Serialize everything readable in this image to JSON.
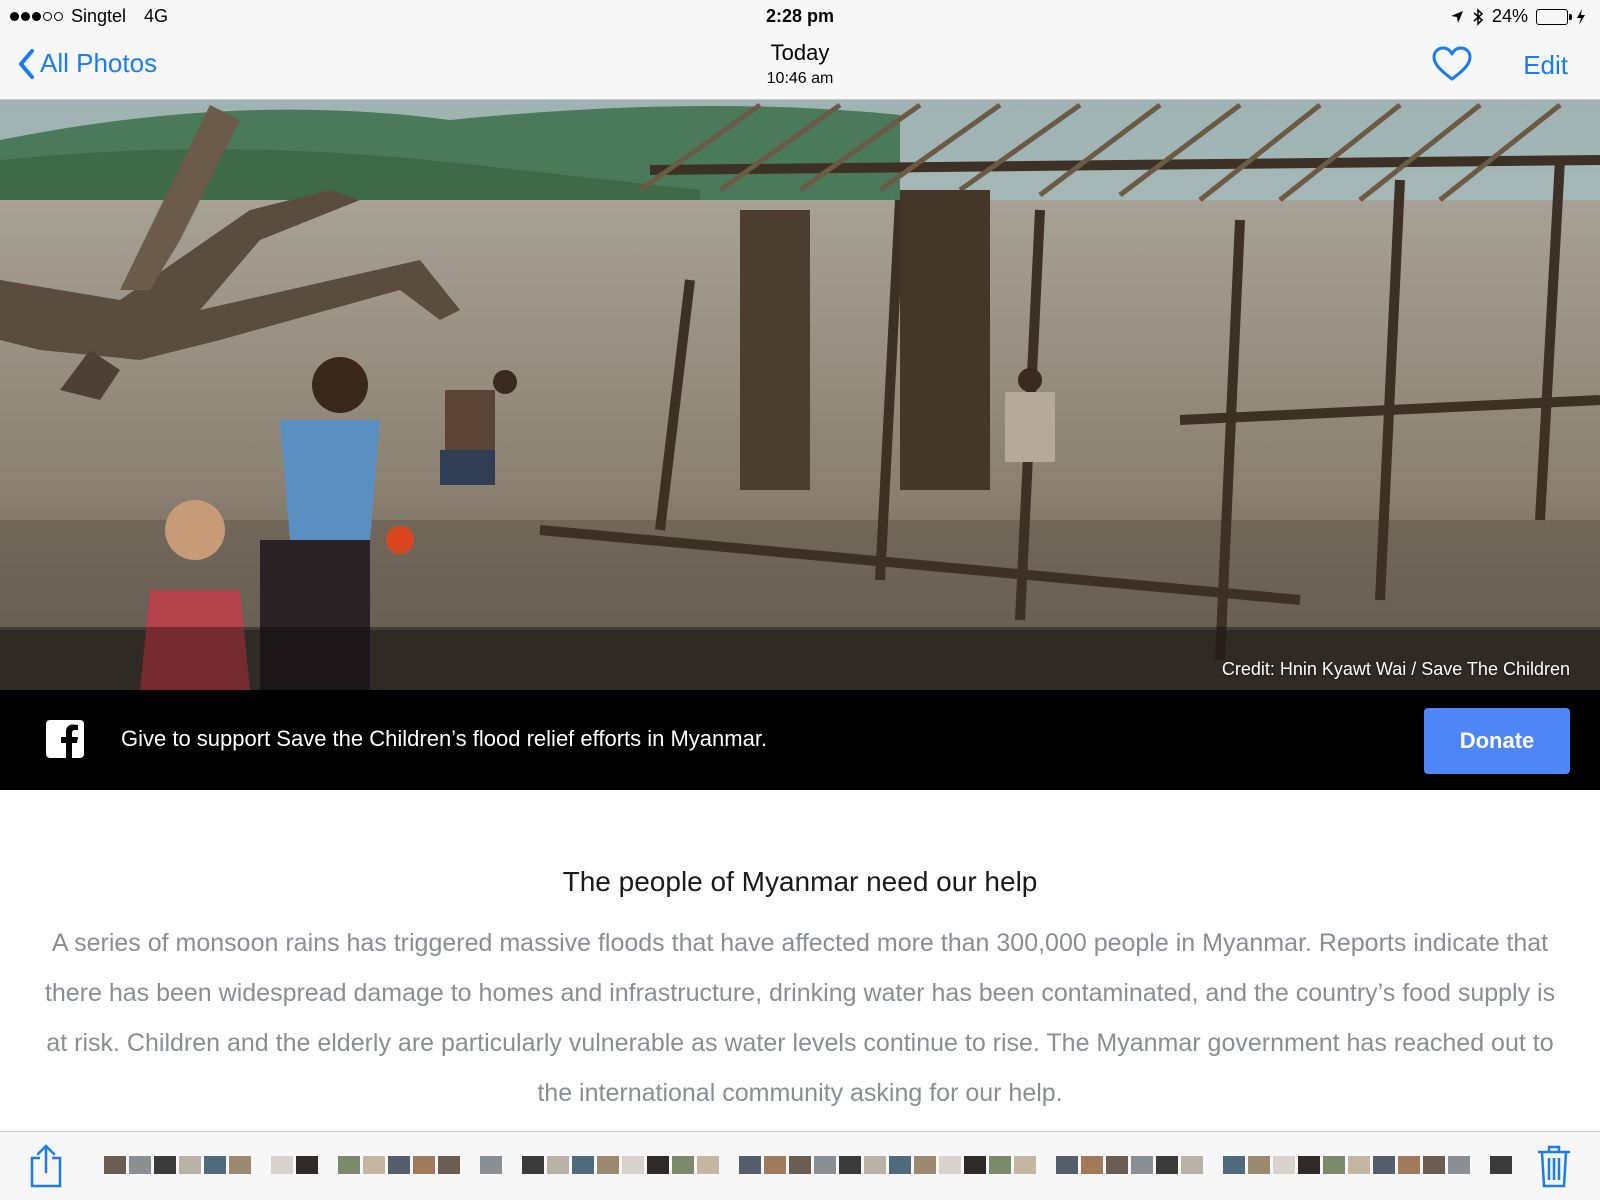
{
  "status_bar": {
    "carrier": "Singtel",
    "network": "4G",
    "time": "2:28 pm",
    "battery_percent": "24%",
    "battery_level": 0.24,
    "battery_color": "#4cd964"
  },
  "nav": {
    "back_label": "All Photos",
    "title": "Today",
    "subtitle": "10:46 am",
    "edit_label": "Edit",
    "accent_color": "#1a7cf5"
  },
  "photo": {
    "credit": "Credit: Hnin Kyawt Wai / Save The Children"
  },
  "banner": {
    "text": "Give to support Save the Children’s flood relief efforts in Myanmar.",
    "donate_label": "Donate",
    "donate_color": "#4e86f7"
  },
  "article": {
    "title": "The people of Myanmar need our help",
    "body": "A series of monsoon rains has triggered massive floods that have affected more than 300,000 people in Myanmar. Reports indicate that there has been widespread damage to homes and infrastructure, drinking water has been contaminated, and the country’s food supply is at risk. Children and the elderly are particularly vulnerable as water levels continue to rise. The Myanmar government has reached out to the international community asking for our help."
  },
  "toolbar": {
    "icons": [
      "share-icon",
      "trash-icon"
    ]
  }
}
